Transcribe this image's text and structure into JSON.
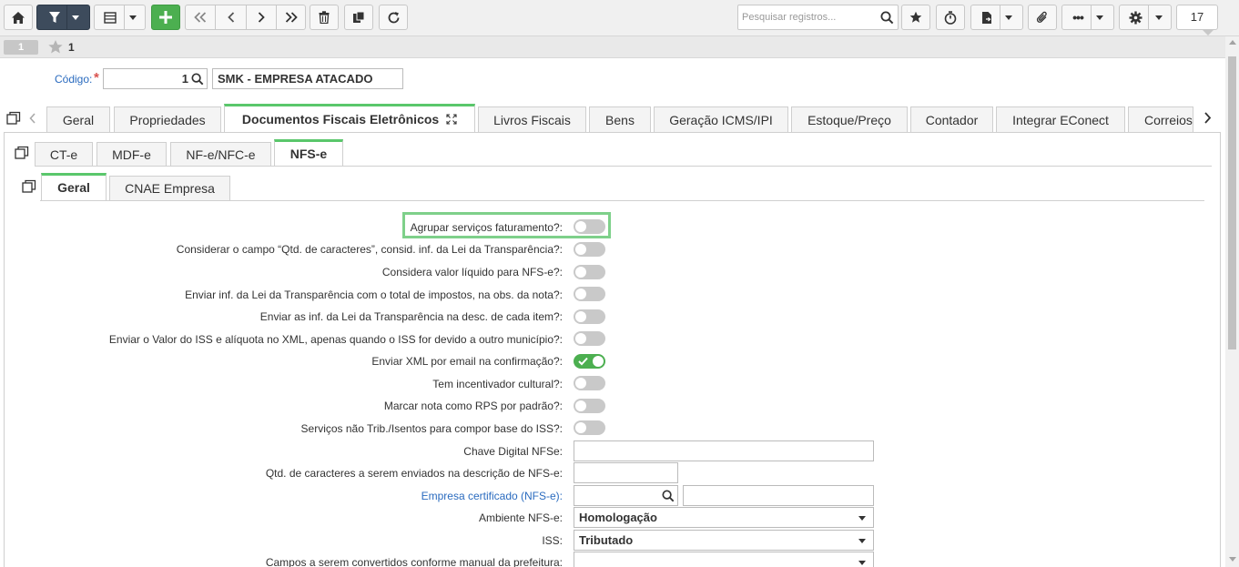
{
  "toolbar": {
    "search_placeholder": "Pesquisar registros...",
    "counter": "17"
  },
  "record": {
    "pill": "1",
    "number": "1"
  },
  "header": {
    "code_label": "Código:",
    "required_mark": "*",
    "code_value": "1",
    "company_name": "SMK - EMPRESA ATACADO"
  },
  "tabs": [
    {
      "label": "Geral"
    },
    {
      "label": "Propriedades"
    },
    {
      "label": "Documentos Fiscais Eletrônicos"
    },
    {
      "label": "Livros Fiscais"
    },
    {
      "label": "Bens"
    },
    {
      "label": "Geração ICMS/IPI"
    },
    {
      "label": "Estoque/Preço"
    },
    {
      "label": "Contador"
    },
    {
      "label": "Integrar EConect"
    },
    {
      "label": "Correios"
    }
  ],
  "subtabs": [
    {
      "label": "CT-e"
    },
    {
      "label": "MDF-e"
    },
    {
      "label": "NF-e/NFC-e"
    },
    {
      "label": "NFS-e"
    }
  ],
  "subsubtabs": [
    {
      "label": "Geral"
    },
    {
      "label": "CNAE Empresa"
    }
  ],
  "form": {
    "toggles": [
      {
        "label": "Agrupar serviços faturamento?:",
        "on": false
      },
      {
        "label": "Considerar o campo “Qtd. de caracteres”, consid. inf. da Lei da Transparência?:",
        "on": false
      },
      {
        "label": "Considera valor líquido para NFS-e?:",
        "on": false
      },
      {
        "label": "Enviar inf. da Lei da Transparência com o total de impostos, na obs. da nota?:",
        "on": false
      },
      {
        "label": "Enviar as inf. da Lei da Transparência na desc. de cada item?:",
        "on": false
      },
      {
        "label": "Enviar o Valor do ISS e alíquota no XML, apenas quando o ISS for devido a outro município?:",
        "on": false
      },
      {
        "label": "Enviar XML por email na confirmação?:",
        "on": true
      },
      {
        "label": "Tem incentivador cultural?:",
        "on": false
      },
      {
        "label": "Marcar nota como RPS por padrão?:",
        "on": false
      },
      {
        "label": "Serviços não Trib./Isentos para compor base do ISS?:",
        "on": false
      }
    ],
    "chave_label": "Chave Digital NFSe:",
    "qtd_label": "Qtd. de caracteres a serem enviados na descrição de NFS-e:",
    "empresa_cert_label": "Empresa certificado (NFS-e):",
    "ambiente_label": "Ambiente NFS-e:",
    "ambiente_value": "Homologação",
    "iss_label": "ISS:",
    "iss_value": "Tributado",
    "campos_label": "Campos a serem convertidos conforme manual da prefeitura:"
  },
  "colors": {
    "accent": "#5ac76b",
    "toggle_on": "#4caf50",
    "link": "#2a6bbf"
  }
}
